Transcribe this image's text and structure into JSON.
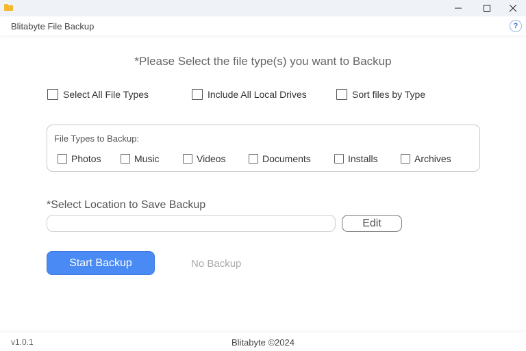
{
  "window": {
    "title": "Blitabyte File Backup",
    "controls": {
      "minimize": "—",
      "maximize": "☐",
      "close": "✕"
    },
    "help_label": "?"
  },
  "main": {
    "prompt": "*Please Select the file type(s) you want to Backup",
    "options": [
      {
        "label": "Select All File Types",
        "checked": false
      },
      {
        "label": "Include All Local Drives",
        "checked": false
      },
      {
        "label": "Sort files by Type",
        "checked": false
      }
    ],
    "file_types": {
      "title": "File Types to Backup:",
      "items": [
        {
          "label": "Photos",
          "checked": false
        },
        {
          "label": "Music",
          "checked": false
        },
        {
          "label": "Videos",
          "checked": false
        },
        {
          "label": "Documents",
          "checked": false
        },
        {
          "label": "Installs",
          "checked": false
        },
        {
          "label": "Archives",
          "checked": false
        }
      ]
    },
    "location": {
      "label": "*Select Location to Save Backup",
      "value": "",
      "edit_label": "Edit"
    },
    "start_label": "Start Backup",
    "status": "No Backup"
  },
  "footer": {
    "version": "v1.0.1",
    "copyright": "Blitabyte ©2024"
  },
  "colors": {
    "accent": "#4a8af4",
    "titlebar": "#eff2f6",
    "app_icon": "#f5b82e"
  }
}
